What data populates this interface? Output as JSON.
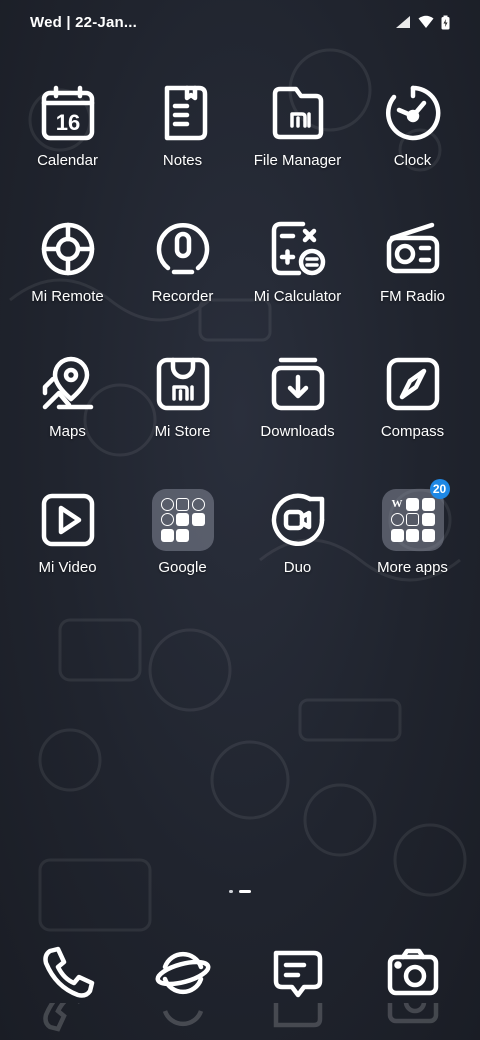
{
  "status_bar": {
    "datetime": "Wed | 22-Jan..."
  },
  "apps": [
    {
      "label": "Calendar",
      "icon": "calendar-icon",
      "day": "16"
    },
    {
      "label": "Notes",
      "icon": "notes-icon"
    },
    {
      "label": "File Manager",
      "icon": "folder-icon",
      "brand": "mi"
    },
    {
      "label": "Clock",
      "icon": "clock-icon"
    },
    {
      "label": "Mi Remote",
      "icon": "remote-icon"
    },
    {
      "label": "Recorder",
      "icon": "recorder-icon"
    },
    {
      "label": "Mi Calculator",
      "icon": "calculator-icon"
    },
    {
      "label": "FM Radio",
      "icon": "radio-icon"
    },
    {
      "label": "Maps",
      "icon": "map-pin-icon"
    },
    {
      "label": "Mi Store",
      "icon": "store-bag-icon",
      "brand": "mi"
    },
    {
      "label": "Downloads",
      "icon": "download-icon"
    },
    {
      "label": "Compass",
      "icon": "compass-icon"
    },
    {
      "label": "Mi Video",
      "icon": "play-icon"
    },
    {
      "label": "Google",
      "icon": "folder-group-icon"
    },
    {
      "label": "Duo",
      "icon": "video-call-icon"
    },
    {
      "label": "More apps",
      "icon": "folder-group-icon",
      "badge": "20"
    }
  ],
  "dock": [
    {
      "icon": "phone-icon"
    },
    {
      "icon": "planet-browser-icon"
    },
    {
      "icon": "messages-icon"
    },
    {
      "icon": "camera-icon"
    }
  ],
  "colors": {
    "background": "#20242e",
    "icon_stroke": "#ffffff",
    "badge": "#1e88e5"
  }
}
